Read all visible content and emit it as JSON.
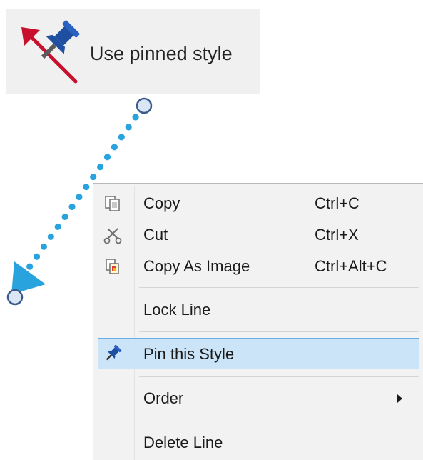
{
  "tooltip": {
    "label": "Use pinned style",
    "icon": "pinned-style-icon"
  },
  "connector": {
    "style": "dotted",
    "color": "#29a3dd",
    "start_handle": "endpoint-handle",
    "end_handle": "endpoint-handle",
    "arrowhead": "filled-triangle"
  },
  "context_menu": {
    "items": [
      {
        "label": "Copy",
        "shortcut": "Ctrl+C",
        "icon": "copy-icon"
      },
      {
        "label": "Cut",
        "shortcut": "Ctrl+X",
        "icon": "scissors-icon"
      },
      {
        "label": "Copy As Image",
        "shortcut": "Ctrl+Alt+C",
        "icon": "copy-image-icon"
      },
      {
        "label": "Lock Line",
        "shortcut": "",
        "icon": ""
      },
      {
        "label": "Pin this Style",
        "shortcut": "",
        "icon": "pushpin-icon",
        "highlighted": true
      },
      {
        "label": "Order",
        "shortcut": "",
        "icon": "",
        "submenu": true
      },
      {
        "label": "Delete Line",
        "shortcut": "",
        "icon": ""
      }
    ]
  },
  "colors": {
    "menu_background": "#f2f2f2",
    "highlight_background": "#cce4f7",
    "highlight_border": "#6aaee6",
    "line_color": "#29a3dd",
    "pin_blue": "#1f4fa0",
    "arrow_red": "#c8102e"
  }
}
